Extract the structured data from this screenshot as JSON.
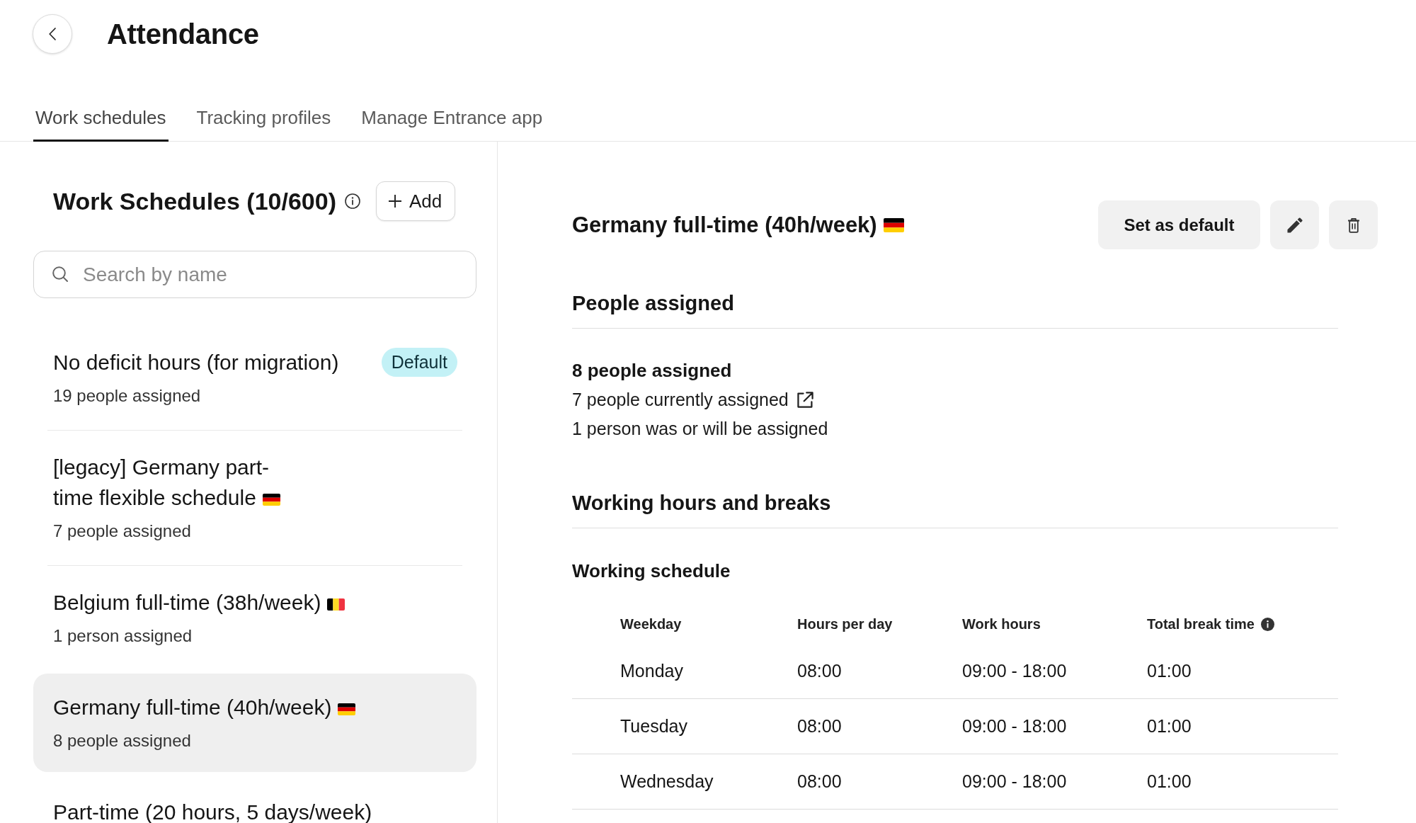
{
  "header": {
    "title": "Attendance"
  },
  "tabs": [
    {
      "label": "Work schedules",
      "selected": true
    },
    {
      "label": "Tracking profiles",
      "selected": false
    },
    {
      "label": "Manage Entrance app",
      "selected": false
    }
  ],
  "schedule_list": {
    "title": "Work Schedules (10/600)",
    "add_button": "Add",
    "search": {
      "placeholder": "Search by name"
    },
    "items": [
      {
        "kind": "plain",
        "name": "No deficit hours (for migration)",
        "assigned": "19 people assigned",
        "badge": "Default",
        "selected": false
      },
      {
        "kind": "germany",
        "name": "[legacy] Germany part-time flexible schedule",
        "assigned": "7 people assigned",
        "selected": false
      },
      {
        "kind": "belgium",
        "name": "Belgium full-time (38h/week)",
        "assigned": "1 person assigned",
        "selected": false
      },
      {
        "kind": "germany",
        "name": "Germany full-time (40h/week)",
        "assigned": "8 people assigned",
        "selected": true
      },
      {
        "kind": "plain",
        "name": "Part-time (20 hours, 5 days/week)",
        "selected": false
      }
    ]
  },
  "detail": {
    "kind": "germany",
    "title": "Germany full-time (40h/week)",
    "set_default_button": "Set as default",
    "people": {
      "heading": "People assigned",
      "total": "8 people assigned",
      "current": "7 people currently assigned",
      "other": "1 person was or will be assigned"
    },
    "hours": {
      "heading": "Working hours and breaks",
      "subheading": "Working schedule",
      "table": {
        "columns": [
          {
            "label": "Weekday",
            "info": false
          },
          {
            "label": "Hours per day",
            "info": false
          },
          {
            "label": "Work hours",
            "info": false
          },
          {
            "label": "Total break time",
            "info": true
          }
        ],
        "rows": [
          [
            "Monday",
            "08:00",
            "09:00 - 18:00",
            "01:00"
          ],
          [
            "Tuesday",
            "08:00",
            "09:00 - 18:00",
            "01:00"
          ],
          [
            "Wednesday",
            "08:00",
            "09:00 - 18:00",
            "01:00"
          ]
        ]
      }
    }
  }
}
